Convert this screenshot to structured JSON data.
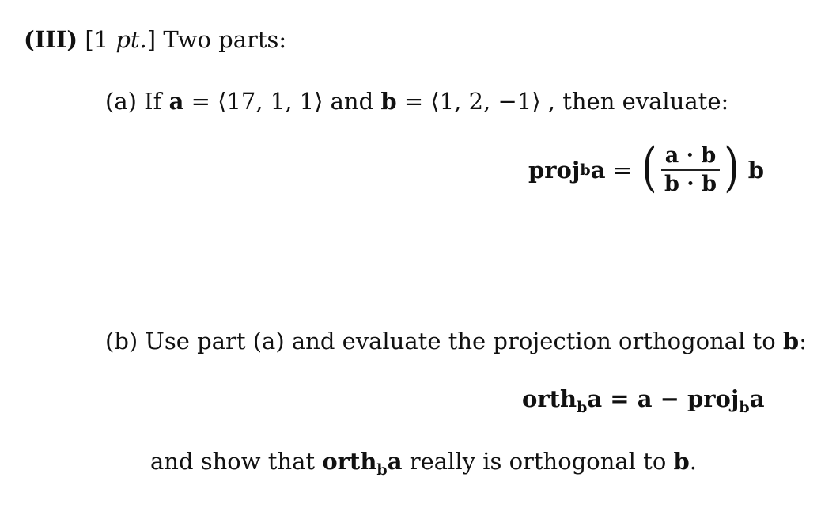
{
  "heading": {
    "number": "(III)",
    "points_open": "[1 ",
    "points_unit": "pt.",
    "points_close": "]",
    "title": " Two parts:"
  },
  "part_a": {
    "label": "(a)",
    "text_if": " If ",
    "vec_a": "a",
    "eq_a": " = ⟨17,  1,  1⟩",
    "and": "  and  ",
    "vec_b": "b",
    "eq_b": " = ⟨1,  2,  −1⟩",
    "tail": " , then evaluate:"
  },
  "proj_formula": {
    "lhs_op": "proj",
    "lhs_sub": "b",
    "lhs_vec": "a",
    "equals": " = ",
    "paren_open": "(",
    "numerator": "a · b",
    "denominator": "b · b",
    "paren_close": ")",
    "rhs_vec": "b"
  },
  "part_b": {
    "label": "(b)",
    "text": " Use part (a) and evaluate the projection orthogonal to ",
    "vec_b": "b",
    "colon": ":"
  },
  "orth_formula": {
    "lhs_op": "orth",
    "lhs_sub": "b",
    "lhs_vec": "a",
    "equals_a_minus": " = a − ",
    "rhs_op": "proj",
    "rhs_sub": "b",
    "rhs_vec": "a"
  },
  "show_line": {
    "text_start": "and show that ",
    "op": "orth",
    "sub": "b",
    "vec": "a",
    "text_mid": " really is orthogonal to ",
    "vec_b": "b",
    "period": "."
  }
}
